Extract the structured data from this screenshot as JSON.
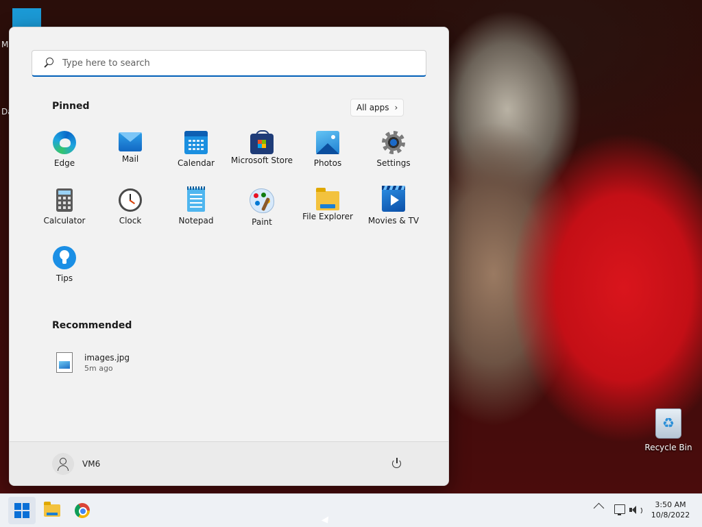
{
  "desktop": {
    "top_left_fragment_1": "M",
    "top_left_fragment_2": "Da",
    "recycle_bin_label": "Recycle Bin"
  },
  "start_menu": {
    "search": {
      "placeholder": "Type here to search",
      "icon": "search-icon"
    },
    "pinned_title": "Pinned",
    "all_apps_label": "All apps",
    "pinned_apps": [
      {
        "label": "Edge",
        "icon": "edge-icon"
      },
      {
        "label": "Mail",
        "icon": "mail-icon"
      },
      {
        "label": "Calendar",
        "icon": "calendar-icon"
      },
      {
        "label": "Microsoft Store",
        "icon": "store-icon"
      },
      {
        "label": "Photos",
        "icon": "photos-icon"
      },
      {
        "label": "Settings",
        "icon": "gear-icon"
      },
      {
        "label": "Calculator",
        "icon": "calculator-icon"
      },
      {
        "label": "Clock",
        "icon": "clock-icon"
      },
      {
        "label": "Notepad",
        "icon": "notepad-icon"
      },
      {
        "label": "Paint",
        "icon": "paint-icon"
      },
      {
        "label": "File Explorer",
        "icon": "folder-icon"
      },
      {
        "label": "Movies & TV",
        "icon": "movies-icon"
      },
      {
        "label": "Tips",
        "icon": "lightbulb-icon"
      }
    ],
    "recommended_title": "Recommended",
    "recommended": [
      {
        "name": "images.jpg",
        "time": "5m ago",
        "icon": "image-file-icon"
      }
    ],
    "user": {
      "name": "VM6",
      "icon": "user-icon"
    },
    "power_icon": "power-icon"
  },
  "taskbar": {
    "pinned": [
      "start-icon",
      "file-explorer-icon",
      "chrome-icon"
    ],
    "tray_icons": [
      "chevron-up-icon",
      "network-icon",
      "volume-icon"
    ],
    "time": "3:50 AM",
    "date": "10/8/2022"
  },
  "colors": {
    "accent": "#005fb8",
    "start_logo": "#0a6fd6",
    "menu_bg": "#f2f2f2",
    "taskbar_bg": "#eef1f5"
  }
}
